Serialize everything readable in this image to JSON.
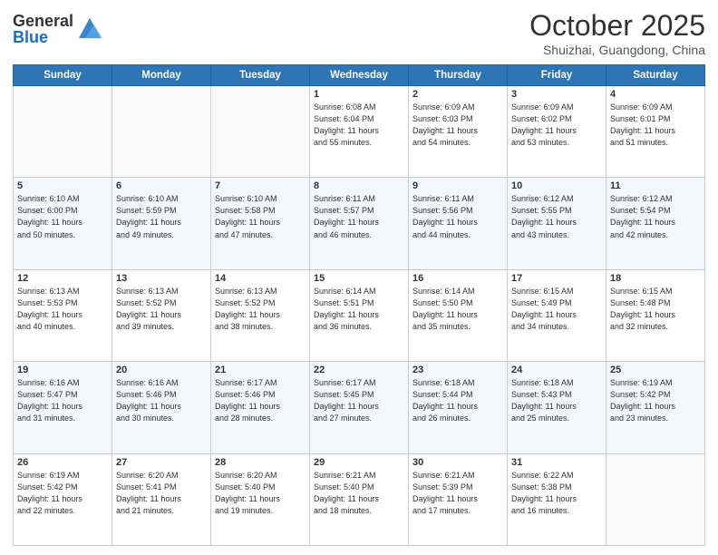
{
  "header": {
    "logo": {
      "line1": "General",
      "line2": "Blue"
    },
    "title": "October 2025",
    "location": "Shuizhai, Guangdong, China"
  },
  "days_of_week": [
    "Sunday",
    "Monday",
    "Tuesday",
    "Wednesday",
    "Thursday",
    "Friday",
    "Saturday"
  ],
  "weeks": [
    [
      {
        "day": "",
        "info": ""
      },
      {
        "day": "",
        "info": ""
      },
      {
        "day": "",
        "info": ""
      },
      {
        "day": "1",
        "info": "Sunrise: 6:08 AM\nSunset: 6:04 PM\nDaylight: 11 hours\nand 55 minutes."
      },
      {
        "day": "2",
        "info": "Sunrise: 6:09 AM\nSunset: 6:03 PM\nDaylight: 11 hours\nand 54 minutes."
      },
      {
        "day": "3",
        "info": "Sunrise: 6:09 AM\nSunset: 6:02 PM\nDaylight: 11 hours\nand 53 minutes."
      },
      {
        "day": "4",
        "info": "Sunrise: 6:09 AM\nSunset: 6:01 PM\nDaylight: 11 hours\nand 51 minutes."
      }
    ],
    [
      {
        "day": "5",
        "info": "Sunrise: 6:10 AM\nSunset: 6:00 PM\nDaylight: 11 hours\nand 50 minutes."
      },
      {
        "day": "6",
        "info": "Sunrise: 6:10 AM\nSunset: 5:59 PM\nDaylight: 11 hours\nand 49 minutes."
      },
      {
        "day": "7",
        "info": "Sunrise: 6:10 AM\nSunset: 5:58 PM\nDaylight: 11 hours\nand 47 minutes."
      },
      {
        "day": "8",
        "info": "Sunrise: 6:11 AM\nSunset: 5:57 PM\nDaylight: 11 hours\nand 46 minutes."
      },
      {
        "day": "9",
        "info": "Sunrise: 6:11 AM\nSunset: 5:56 PM\nDaylight: 11 hours\nand 44 minutes."
      },
      {
        "day": "10",
        "info": "Sunrise: 6:12 AM\nSunset: 5:55 PM\nDaylight: 11 hours\nand 43 minutes."
      },
      {
        "day": "11",
        "info": "Sunrise: 6:12 AM\nSunset: 5:54 PM\nDaylight: 11 hours\nand 42 minutes."
      }
    ],
    [
      {
        "day": "12",
        "info": "Sunrise: 6:13 AM\nSunset: 5:53 PM\nDaylight: 11 hours\nand 40 minutes."
      },
      {
        "day": "13",
        "info": "Sunrise: 6:13 AM\nSunset: 5:52 PM\nDaylight: 11 hours\nand 39 minutes."
      },
      {
        "day": "14",
        "info": "Sunrise: 6:13 AM\nSunset: 5:52 PM\nDaylight: 11 hours\nand 38 minutes."
      },
      {
        "day": "15",
        "info": "Sunrise: 6:14 AM\nSunset: 5:51 PM\nDaylight: 11 hours\nand 36 minutes."
      },
      {
        "day": "16",
        "info": "Sunrise: 6:14 AM\nSunset: 5:50 PM\nDaylight: 11 hours\nand 35 minutes."
      },
      {
        "day": "17",
        "info": "Sunrise: 6:15 AM\nSunset: 5:49 PM\nDaylight: 11 hours\nand 34 minutes."
      },
      {
        "day": "18",
        "info": "Sunrise: 6:15 AM\nSunset: 5:48 PM\nDaylight: 11 hours\nand 32 minutes."
      }
    ],
    [
      {
        "day": "19",
        "info": "Sunrise: 6:16 AM\nSunset: 5:47 PM\nDaylight: 11 hours\nand 31 minutes."
      },
      {
        "day": "20",
        "info": "Sunrise: 6:16 AM\nSunset: 5:46 PM\nDaylight: 11 hours\nand 30 minutes."
      },
      {
        "day": "21",
        "info": "Sunrise: 6:17 AM\nSunset: 5:46 PM\nDaylight: 11 hours\nand 28 minutes."
      },
      {
        "day": "22",
        "info": "Sunrise: 6:17 AM\nSunset: 5:45 PM\nDaylight: 11 hours\nand 27 minutes."
      },
      {
        "day": "23",
        "info": "Sunrise: 6:18 AM\nSunset: 5:44 PM\nDaylight: 11 hours\nand 26 minutes."
      },
      {
        "day": "24",
        "info": "Sunrise: 6:18 AM\nSunset: 5:43 PM\nDaylight: 11 hours\nand 25 minutes."
      },
      {
        "day": "25",
        "info": "Sunrise: 6:19 AM\nSunset: 5:42 PM\nDaylight: 11 hours\nand 23 minutes."
      }
    ],
    [
      {
        "day": "26",
        "info": "Sunrise: 6:19 AM\nSunset: 5:42 PM\nDaylight: 11 hours\nand 22 minutes."
      },
      {
        "day": "27",
        "info": "Sunrise: 6:20 AM\nSunset: 5:41 PM\nDaylight: 11 hours\nand 21 minutes."
      },
      {
        "day": "28",
        "info": "Sunrise: 6:20 AM\nSunset: 5:40 PM\nDaylight: 11 hours\nand 19 minutes."
      },
      {
        "day": "29",
        "info": "Sunrise: 6:21 AM\nSunset: 5:40 PM\nDaylight: 11 hours\nand 18 minutes."
      },
      {
        "day": "30",
        "info": "Sunrise: 6:21 AM\nSunset: 5:39 PM\nDaylight: 11 hours\nand 17 minutes."
      },
      {
        "day": "31",
        "info": "Sunrise: 6:22 AM\nSunset: 5:38 PM\nDaylight: 11 hours\nand 16 minutes."
      },
      {
        "day": "",
        "info": ""
      }
    ]
  ]
}
